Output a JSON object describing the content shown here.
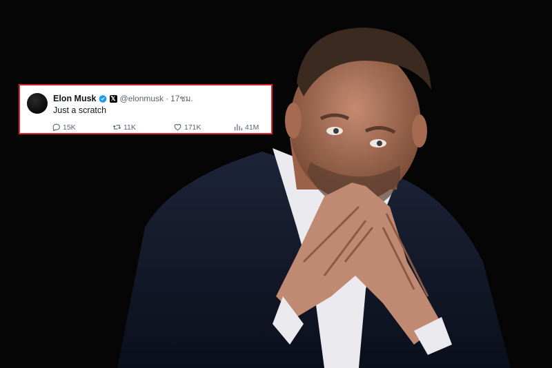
{
  "tweet": {
    "author_name": "Elon Musk",
    "handle": "@elonmusk",
    "separator": "·",
    "time": "17ชม.",
    "text": "Just a scratch",
    "replies": "15K",
    "reposts": "11K",
    "likes": "171K",
    "views": "41M"
  },
  "icons": {
    "verified": "verified-badge-icon",
    "x": "x-logo-icon",
    "reply": "reply-icon",
    "repost": "repost-icon",
    "like": "heart-icon",
    "views": "views-bar-chart-icon"
  },
  "colors": {
    "card_border": "#e0242c",
    "verified": "#1d9bf0",
    "secondary_text": "#536471",
    "background": "#050505"
  }
}
